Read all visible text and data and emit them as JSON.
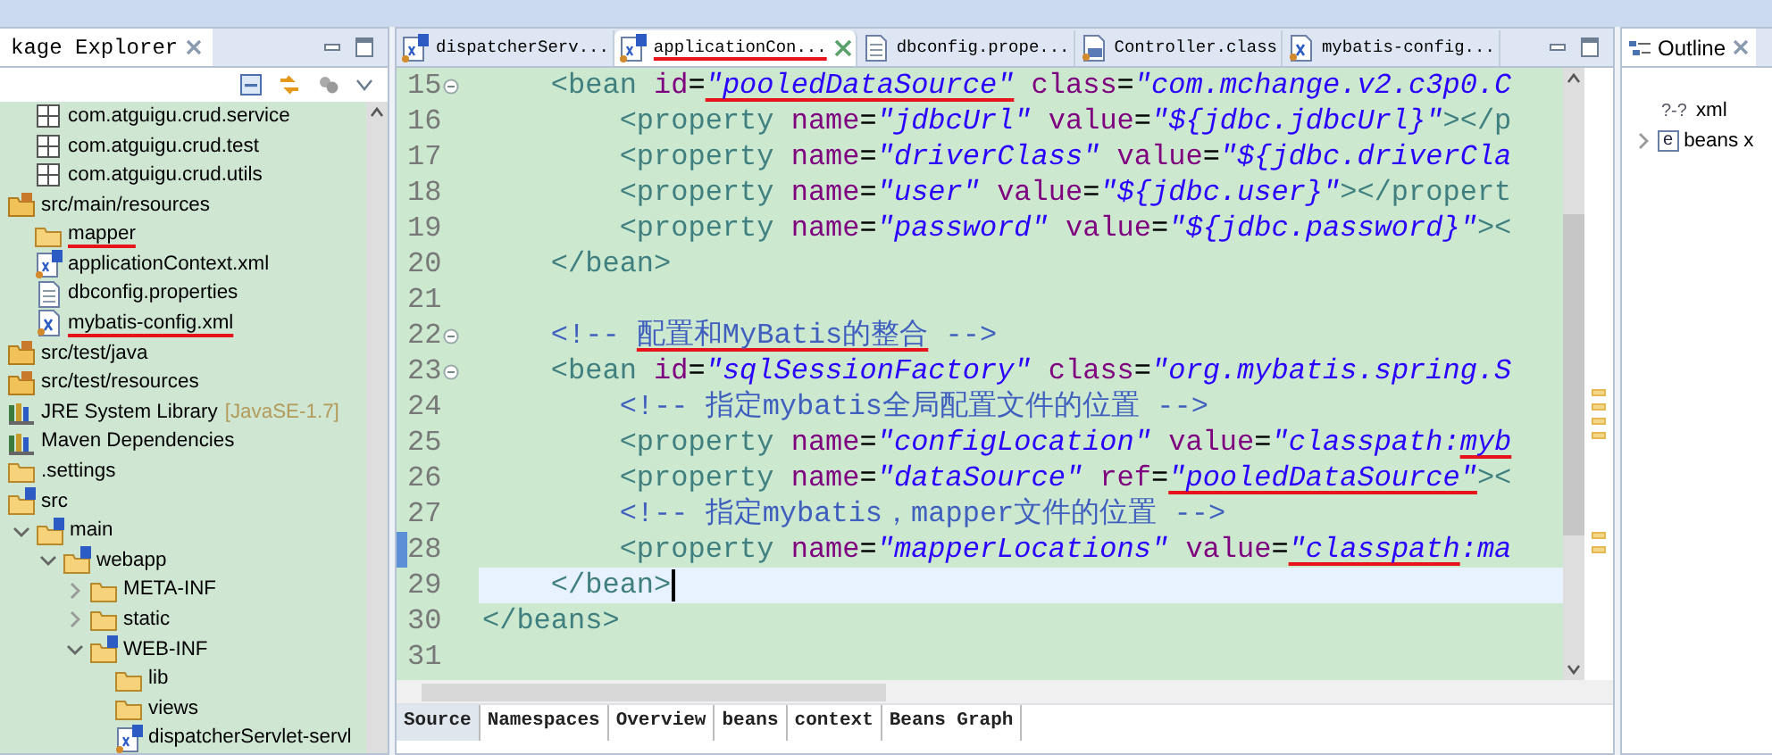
{
  "package_explorer": {
    "title": "kage Explorer",
    "tree": {
      "partial_children": [
        {
          "kind": "package",
          "label": "com.atguigu.crud.service",
          "marked": false
        },
        {
          "kind": "package",
          "label": "com.atguigu.crud.test",
          "marked": false
        },
        {
          "kind": "package",
          "label": "com.atguigu.crud.utils",
          "marked": false
        }
      ],
      "items": [
        {
          "kind": "source_folder",
          "label": "src/main/resources",
          "marked": false,
          "children": [
            {
              "kind": "open_folder",
              "label": "mapper",
              "marked": true
            },
            {
              "kind": "spring_xml",
              "label": "applicationContext.xml",
              "marked": false
            },
            {
              "kind": "properties",
              "label": "dbconfig.properties",
              "marked": false
            },
            {
              "kind": "xml",
              "label": "mybatis-config.xml",
              "marked": true
            }
          ]
        },
        {
          "kind": "source_folder",
          "label": "src/test/java",
          "marked": false
        },
        {
          "kind": "source_folder",
          "label": "src/test/resources",
          "marked": false
        },
        {
          "kind": "library",
          "label": "JRE System Library",
          "decoration": "[JavaSE-1.7]",
          "marked": false
        },
        {
          "kind": "library",
          "label": "Maven Dependencies",
          "marked": false
        },
        {
          "kind": "folder",
          "label": ".settings",
          "marked": false
        },
        {
          "kind": "spring_folder",
          "label": "src",
          "marked": false,
          "children": [
            {
              "kind": "spring_folder",
              "label": "main",
              "expanded": true,
              "marked": false,
              "children": [
                {
                  "kind": "spring_folder",
                  "label": "webapp",
                  "expanded": true,
                  "marked": false,
                  "children": [
                    {
                      "kind": "folder",
                      "label": "META-INF",
                      "expanded": false,
                      "marked": false
                    },
                    {
                      "kind": "folder",
                      "label": "static",
                      "expanded": false,
                      "marked": false
                    },
                    {
                      "kind": "spring_folder",
                      "label": "WEB-INF",
                      "expanded": true,
                      "marked": false,
                      "children": [
                        {
                          "kind": "folder",
                          "label": "lib",
                          "marked": false
                        },
                        {
                          "kind": "folder",
                          "label": "views",
                          "marked": false
                        },
                        {
                          "kind": "spring_xml",
                          "label": "dispatcherServlet-servl",
                          "marked": false
                        }
                      ]
                    }
                  ]
                }
              ]
            }
          ]
        }
      ]
    }
  },
  "editor": {
    "tabs": [
      {
        "kind": "spring_xml",
        "label": "dispatcherServ...",
        "selected": false,
        "marked": false
      },
      {
        "kind": "spring_xml",
        "label": "applicationCon...",
        "selected": true,
        "marked": true
      },
      {
        "kind": "properties",
        "label": "dbconfig.prope...",
        "selected": false,
        "marked": false
      },
      {
        "kind": "class",
        "label": "Controller.class",
        "selected": false,
        "marked": false
      },
      {
        "kind": "xml",
        "label": "mybatis-config...",
        "selected": false,
        "marked": false
      }
    ],
    "lines": [
      {
        "n": "15",
        "fold": true,
        "current": false,
        "changed": false,
        "segments": [
          {
            "s": "    <bean id=",
            "marked": false
          },
          {
            "s": "\"pooledDataSource\"",
            "marked": true
          },
          {
            "s": " class=\"com.mchange.v2.c3p0.C",
            "marked": false
          }
        ]
      },
      {
        "n": "16",
        "fold": false,
        "current": false,
        "changed": false,
        "segments": [
          {
            "s": "        <property name=\"jdbcUrl\" value=\"${jdbc.jdbcUrl}\"></p",
            "marked": false
          }
        ]
      },
      {
        "n": "17",
        "fold": false,
        "current": false,
        "changed": false,
        "segments": [
          {
            "s": "        <property name=\"driverClass\" value=\"${jdbc.driverCla",
            "marked": false
          }
        ]
      },
      {
        "n": "18",
        "fold": false,
        "current": false,
        "changed": false,
        "segments": [
          {
            "s": "        <property name=\"user\" value=\"${jdbc.user}\"></propert",
            "marked": false
          }
        ]
      },
      {
        "n": "19",
        "fold": false,
        "current": false,
        "changed": false,
        "segments": [
          {
            "s": "        <property name=\"password\" value=\"${jdbc.password}\"><",
            "marked": false
          }
        ]
      },
      {
        "n": "20",
        "fold": false,
        "current": false,
        "changed": false,
        "segments": [
          {
            "s": "    </bean>",
            "marked": false
          }
        ]
      },
      {
        "n": "21",
        "fold": false,
        "current": false,
        "changed": false
      },
      {
        "n": "22",
        "fold": true,
        "current": false,
        "changed": false,
        "segments": [
          {
            "s": "    <!-- ",
            "marked": false
          },
          {
            "s": "配置和MyBatis的整合",
            "marked": true
          },
          {
            "s": " -->",
            "marked": false
          }
        ]
      },
      {
        "n": "23",
        "fold": true,
        "current": false,
        "changed": false,
        "segments": [
          {
            "s": "    <bean id=\"sqlSessionFactory\" class=\"org.mybatis.spring.S",
            "marked": false
          }
        ]
      },
      {
        "n": "24",
        "fold": false,
        "current": false,
        "changed": false,
        "segments": [
          {
            "s": "        <!-- 指定mybatis全局配置文件的位置 -->",
            "marked": false
          }
        ]
      },
      {
        "n": "25",
        "fold": false,
        "current": false,
        "changed": false,
        "segments": [
          {
            "s": "        <property name=\"configLocation\" value=\"classpath:",
            "marked": false
          },
          {
            "s": "myb",
            "marked": true
          }
        ]
      },
      {
        "n": "26",
        "fold": false,
        "current": false,
        "changed": false,
        "segments": [
          {
            "s": "        <property name=\"dataSource\" ref=",
            "marked": false
          },
          {
            "s": "\"pooledDataSource\"",
            "marked": true
          },
          {
            "s": "><",
            "marked": false
          }
        ]
      },
      {
        "n": "27",
        "fold": false,
        "current": false,
        "changed": false,
        "segments": [
          {
            "s": "        <!-- 指定mybatis，mapper文件的位置 -->",
            "marked": false
          }
        ]
      },
      {
        "n": "28",
        "fold": false,
        "current": false,
        "changed": true,
        "segments": [
          {
            "s": "        <property name=\"mapperLocations\" value=",
            "marked": false
          },
          {
            "s": "\"classpath",
            "marked": true
          },
          {
            "s": ":ma",
            "marked": false
          }
        ]
      },
      {
        "n": "29",
        "fold": false,
        "current": true,
        "changed": false,
        "segments": [
          {
            "s": "    </bean>",
            "marked": false
          }
        ]
      },
      {
        "n": "30",
        "fold": false,
        "current": false,
        "changed": false,
        "segments": [
          {
            "s": "</beans>",
            "marked": false
          }
        ]
      },
      {
        "n": "31",
        "fold": false,
        "current": false,
        "changed": false
      }
    ],
    "bottom_tabs": [
      {
        "label": "Source",
        "selected": true
      },
      {
        "label": "Namespaces",
        "selected": false
      },
      {
        "label": "Overview",
        "selected": false
      },
      {
        "label": "beans",
        "selected": false
      },
      {
        "label": "context",
        "selected": false
      },
      {
        "label": "Beans Graph",
        "selected": false
      }
    ]
  },
  "outline": {
    "title": "Outline",
    "items": [
      {
        "kind": "declaration",
        "glyph": "?-?",
        "label": "xml"
      },
      {
        "kind": "element",
        "glyph": "e",
        "label": "beans x",
        "expanded": false
      }
    ]
  }
}
